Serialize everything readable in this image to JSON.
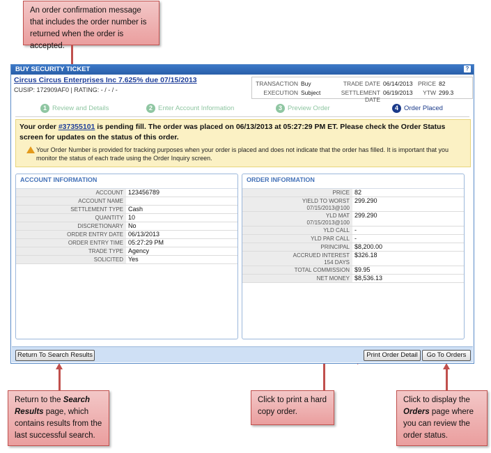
{
  "callouts": {
    "top": "An order confirmation message that includes the order number is returned when the order is accepted.",
    "search_pre": "Return to the ",
    "search_bold": "Search Results",
    "search_post": " page, which contains results from the last successful search.",
    "print": "Click to print a hard copy order.",
    "orders_pre": "Click to display the ",
    "orders_bold": "Orders",
    "orders_post": " page where you can review the order status."
  },
  "window": {
    "title": "BUY SECURITY TICKET",
    "help_icon": "?"
  },
  "security": {
    "name": "Circus Circus Enterprises Inc 7.625% due 07/15/2013",
    "sub": "CUSIP: 172909AF0 | RATING: - / - / -"
  },
  "transaction": {
    "transaction_label": "TRANSACTION",
    "transaction_value": "Buy",
    "execution_label": "EXECUTION",
    "execution_value": "Subject",
    "trade_date_label": "TRADE DATE",
    "trade_date_value": "06/14/2013",
    "settlement_date_label": "SETTLEMENT DATE",
    "settlement_date_value": "06/19/2013",
    "price_label": "PRICE",
    "price_value": "82",
    "ytw_label": "YTW",
    "ytw_value": "299.3"
  },
  "steps": [
    {
      "num": "1",
      "label": "Review and Details"
    },
    {
      "num": "2",
      "label": "Enter Account Information"
    },
    {
      "num": "3",
      "label": "Preview Order"
    },
    {
      "num": "4",
      "label": "Order Placed"
    }
  ],
  "confirmation": {
    "prefix": "Your order ",
    "order_number": "#37355101",
    "suffix": " is pending fill. The order was placed on 06/13/2013 at 05:27:29 PM ET. Please check the Order Status screen for updates on the status of this order.",
    "note": "Your Order Number is provided for tracking purposes when your order is placed and does not indicate that the order has filled. It is important that you monitor the status of each trade using the Order Inquiry screen."
  },
  "account_info": {
    "heading": "ACCOUNT INFORMATION",
    "rows": [
      {
        "k": "ACCOUNT",
        "v": "123456789"
      },
      {
        "k": "ACCOUNT NAME",
        "v": ""
      },
      {
        "k": "SETTLEMENT TYPE",
        "v": "Cash"
      },
      {
        "k": "QUANTITY",
        "v": "10"
      },
      {
        "k": "DISCRETIONARY",
        "v": "No"
      },
      {
        "k": "ORDER ENTRY DATE",
        "v": "06/13/2013"
      },
      {
        "k": "ORDER ENTRY TIME",
        "v": "05:27:29 PM"
      },
      {
        "k": "TRADE TYPE",
        "v": "Agency"
      },
      {
        "k": "SOLICITED",
        "v": "Yes"
      }
    ]
  },
  "order_info": {
    "heading": "ORDER INFORMATION",
    "rows": [
      {
        "k": "PRICE",
        "k2": "",
        "v": "82"
      },
      {
        "k": "YIELD TO WORST",
        "k2": "07/15/2013@100",
        "v": "299.290"
      },
      {
        "k": "YLD MAT",
        "k2": "07/15/2013@100",
        "v": "299.290"
      },
      {
        "k": "YLD CALL",
        "k2": "",
        "v": "-"
      },
      {
        "k": "YLD PAR CALL",
        "k2": "",
        "v": "-"
      },
      {
        "k": "PRINCIPAL",
        "k2": "",
        "v": "$8,200.00"
      },
      {
        "k": "ACCRUED INTEREST",
        "k2": "154 DAYS",
        "v": "$326.18"
      },
      {
        "k": "TOTAL COMMISSION",
        "k2": "",
        "v": "$9.95"
      },
      {
        "k": "NET MONEY",
        "k2": "",
        "v": "$8,536.13"
      }
    ]
  },
  "buttons": {
    "return": "Return To Search Results",
    "print": "Print Order Detail",
    "orders": "Go To Orders"
  }
}
